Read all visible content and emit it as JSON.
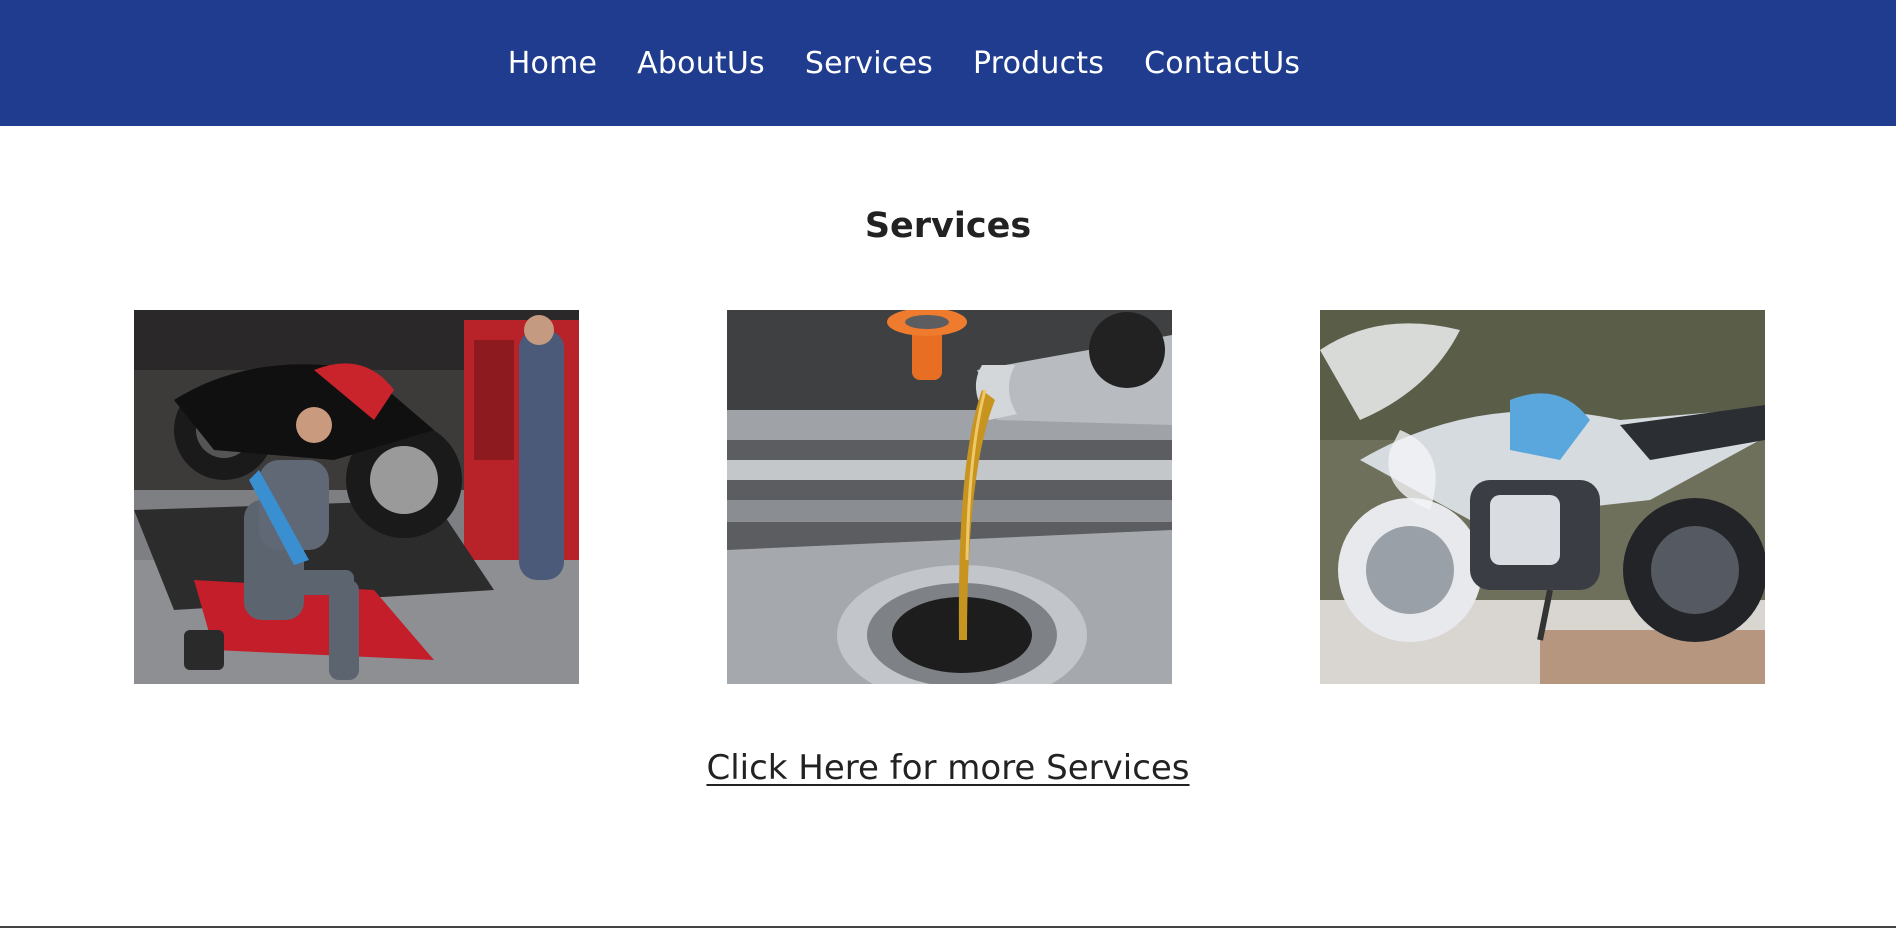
{
  "nav": {
    "items": [
      {
        "label": "Home"
      },
      {
        "label": "AboutUs"
      },
      {
        "label": "Services"
      },
      {
        "label": "Products"
      },
      {
        "label": "ContactUs"
      }
    ],
    "background_color": "#1f3c8f",
    "text_color": "#ffffff"
  },
  "services": {
    "title": "Services",
    "images": [
      {
        "icon": "motorcycle-repair-photo"
      },
      {
        "icon": "engine-oil-pour-photo"
      },
      {
        "icon": "motorcycle-wash-photo"
      }
    ],
    "more_link_label": "Click Here for more Services"
  }
}
